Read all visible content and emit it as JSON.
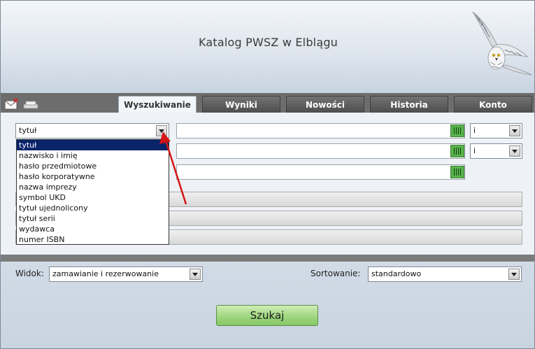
{
  "header": {
    "title": "Katalog PWSZ w Elblągu"
  },
  "tabs": [
    {
      "label": "Wyszukiwanie",
      "active": true
    },
    {
      "label": "Wyniki",
      "active": false
    },
    {
      "label": "Nowości",
      "active": false
    },
    {
      "label": "Historia",
      "active": false
    },
    {
      "label": "Konto",
      "active": false
    }
  ],
  "search": {
    "field_select_value": "tytuł",
    "operator_1": "i",
    "operator_2": "i",
    "dropdown_options": [
      "tytuł",
      "nazwisko i imię",
      "hasło przedmiotowe",
      "hasło korporatywne",
      "nazwa imprezy",
      "symbol UKD",
      "tytuł ujednolicony",
      "tytuł serii",
      "wydawca",
      "numer ISBN"
    ]
  },
  "view": {
    "label": "Widok:",
    "value": "zamawianie i rezerwowanie"
  },
  "sort": {
    "label": "Sortowanie:",
    "value": "standardowo"
  },
  "submit_label": "Szukaj",
  "colors": {
    "tab_bg": "#6d6d6d",
    "selected": "#0a246a",
    "submit_green": "#9fd680",
    "annotation": "#d41515"
  }
}
